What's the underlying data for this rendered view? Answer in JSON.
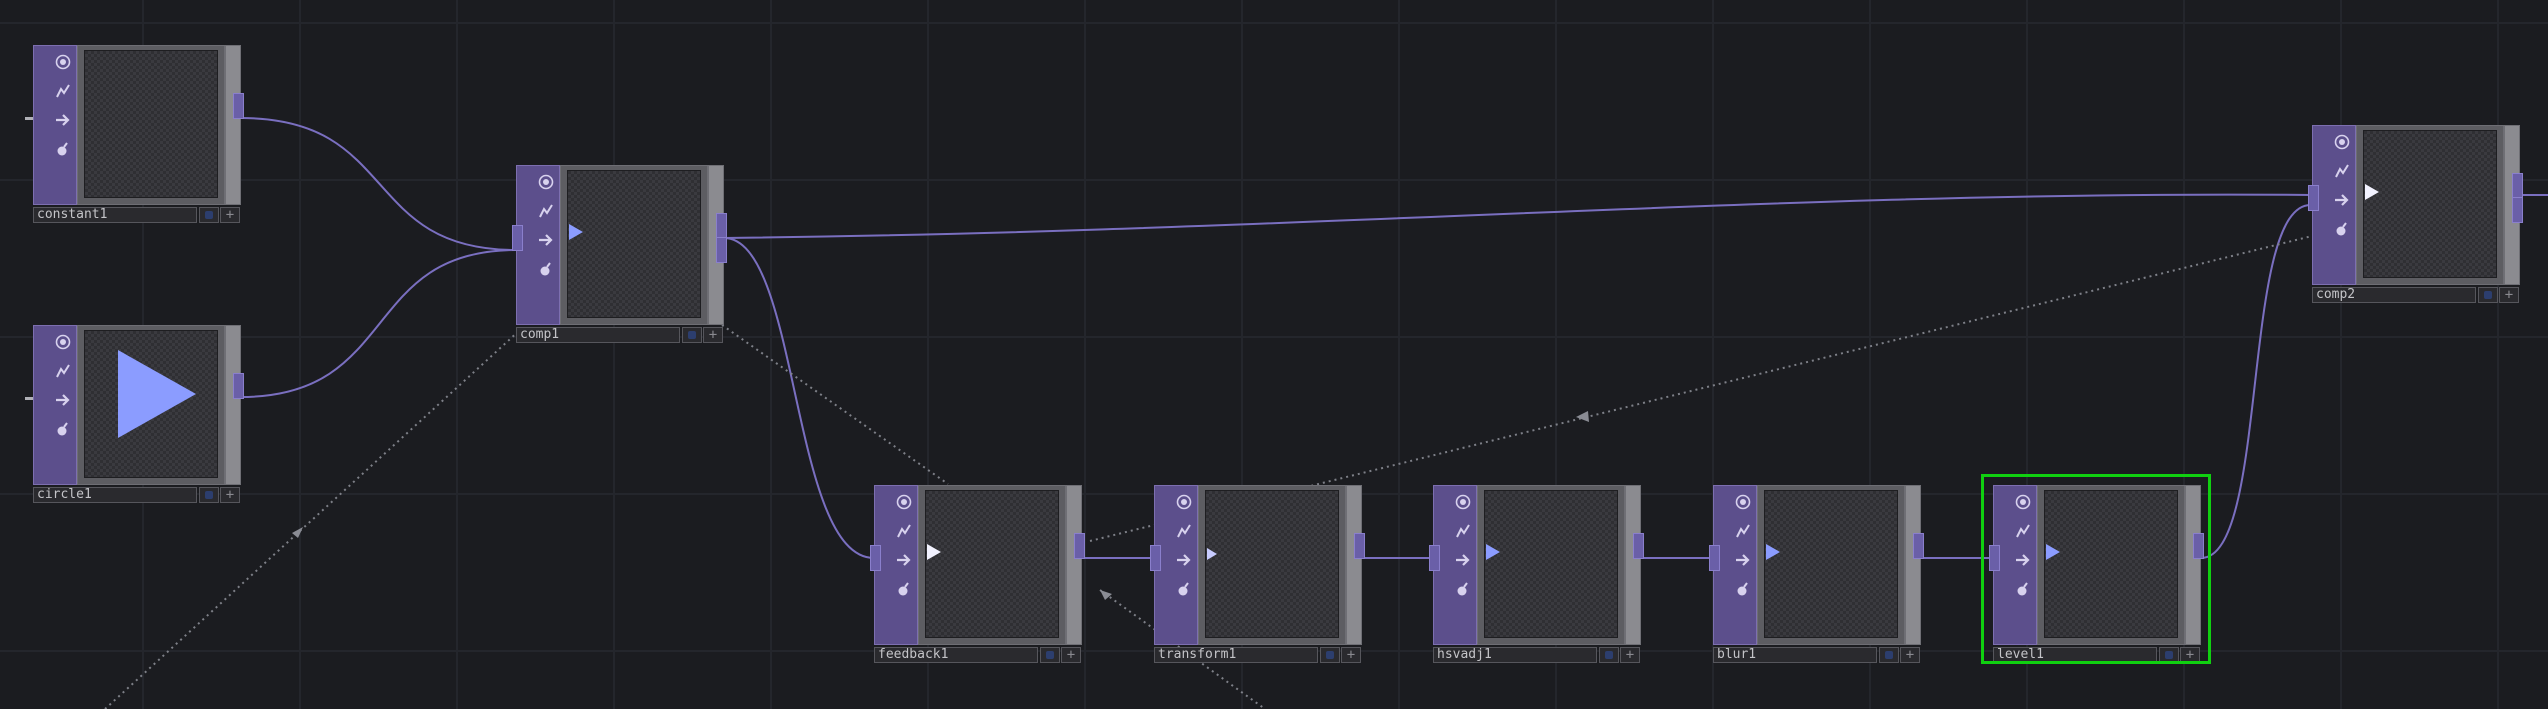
{
  "network": {
    "nodes": [
      {
        "id": "constant1",
        "label": "constant1"
      },
      {
        "id": "circle1",
        "label": "circle1"
      },
      {
        "id": "comp1",
        "label": "comp1"
      },
      {
        "id": "comp2",
        "label": "comp2"
      },
      {
        "id": "feedback1",
        "label": "feedback1"
      },
      {
        "id": "transform1",
        "label": "transform1"
      },
      {
        "id": "hsvadj1",
        "label": "hsvadj1"
      },
      {
        "id": "blur1",
        "label": "blur1"
      },
      {
        "id": "level1",
        "label": "level1"
      }
    ],
    "selected_node": "level1",
    "toggle_icons": [
      "cooking-icon",
      "bypass-icon",
      "display-icon",
      "lock-icon"
    ],
    "label_button_icons": [
      "viewer-active-icon",
      "add-icon"
    ]
  },
  "colors": {
    "background": "#1b1c20",
    "operator_purple": "#5c4f8c",
    "wire": "#7a6fc0",
    "selection": "#10d010",
    "play_marker": "#8b9cff"
  }
}
